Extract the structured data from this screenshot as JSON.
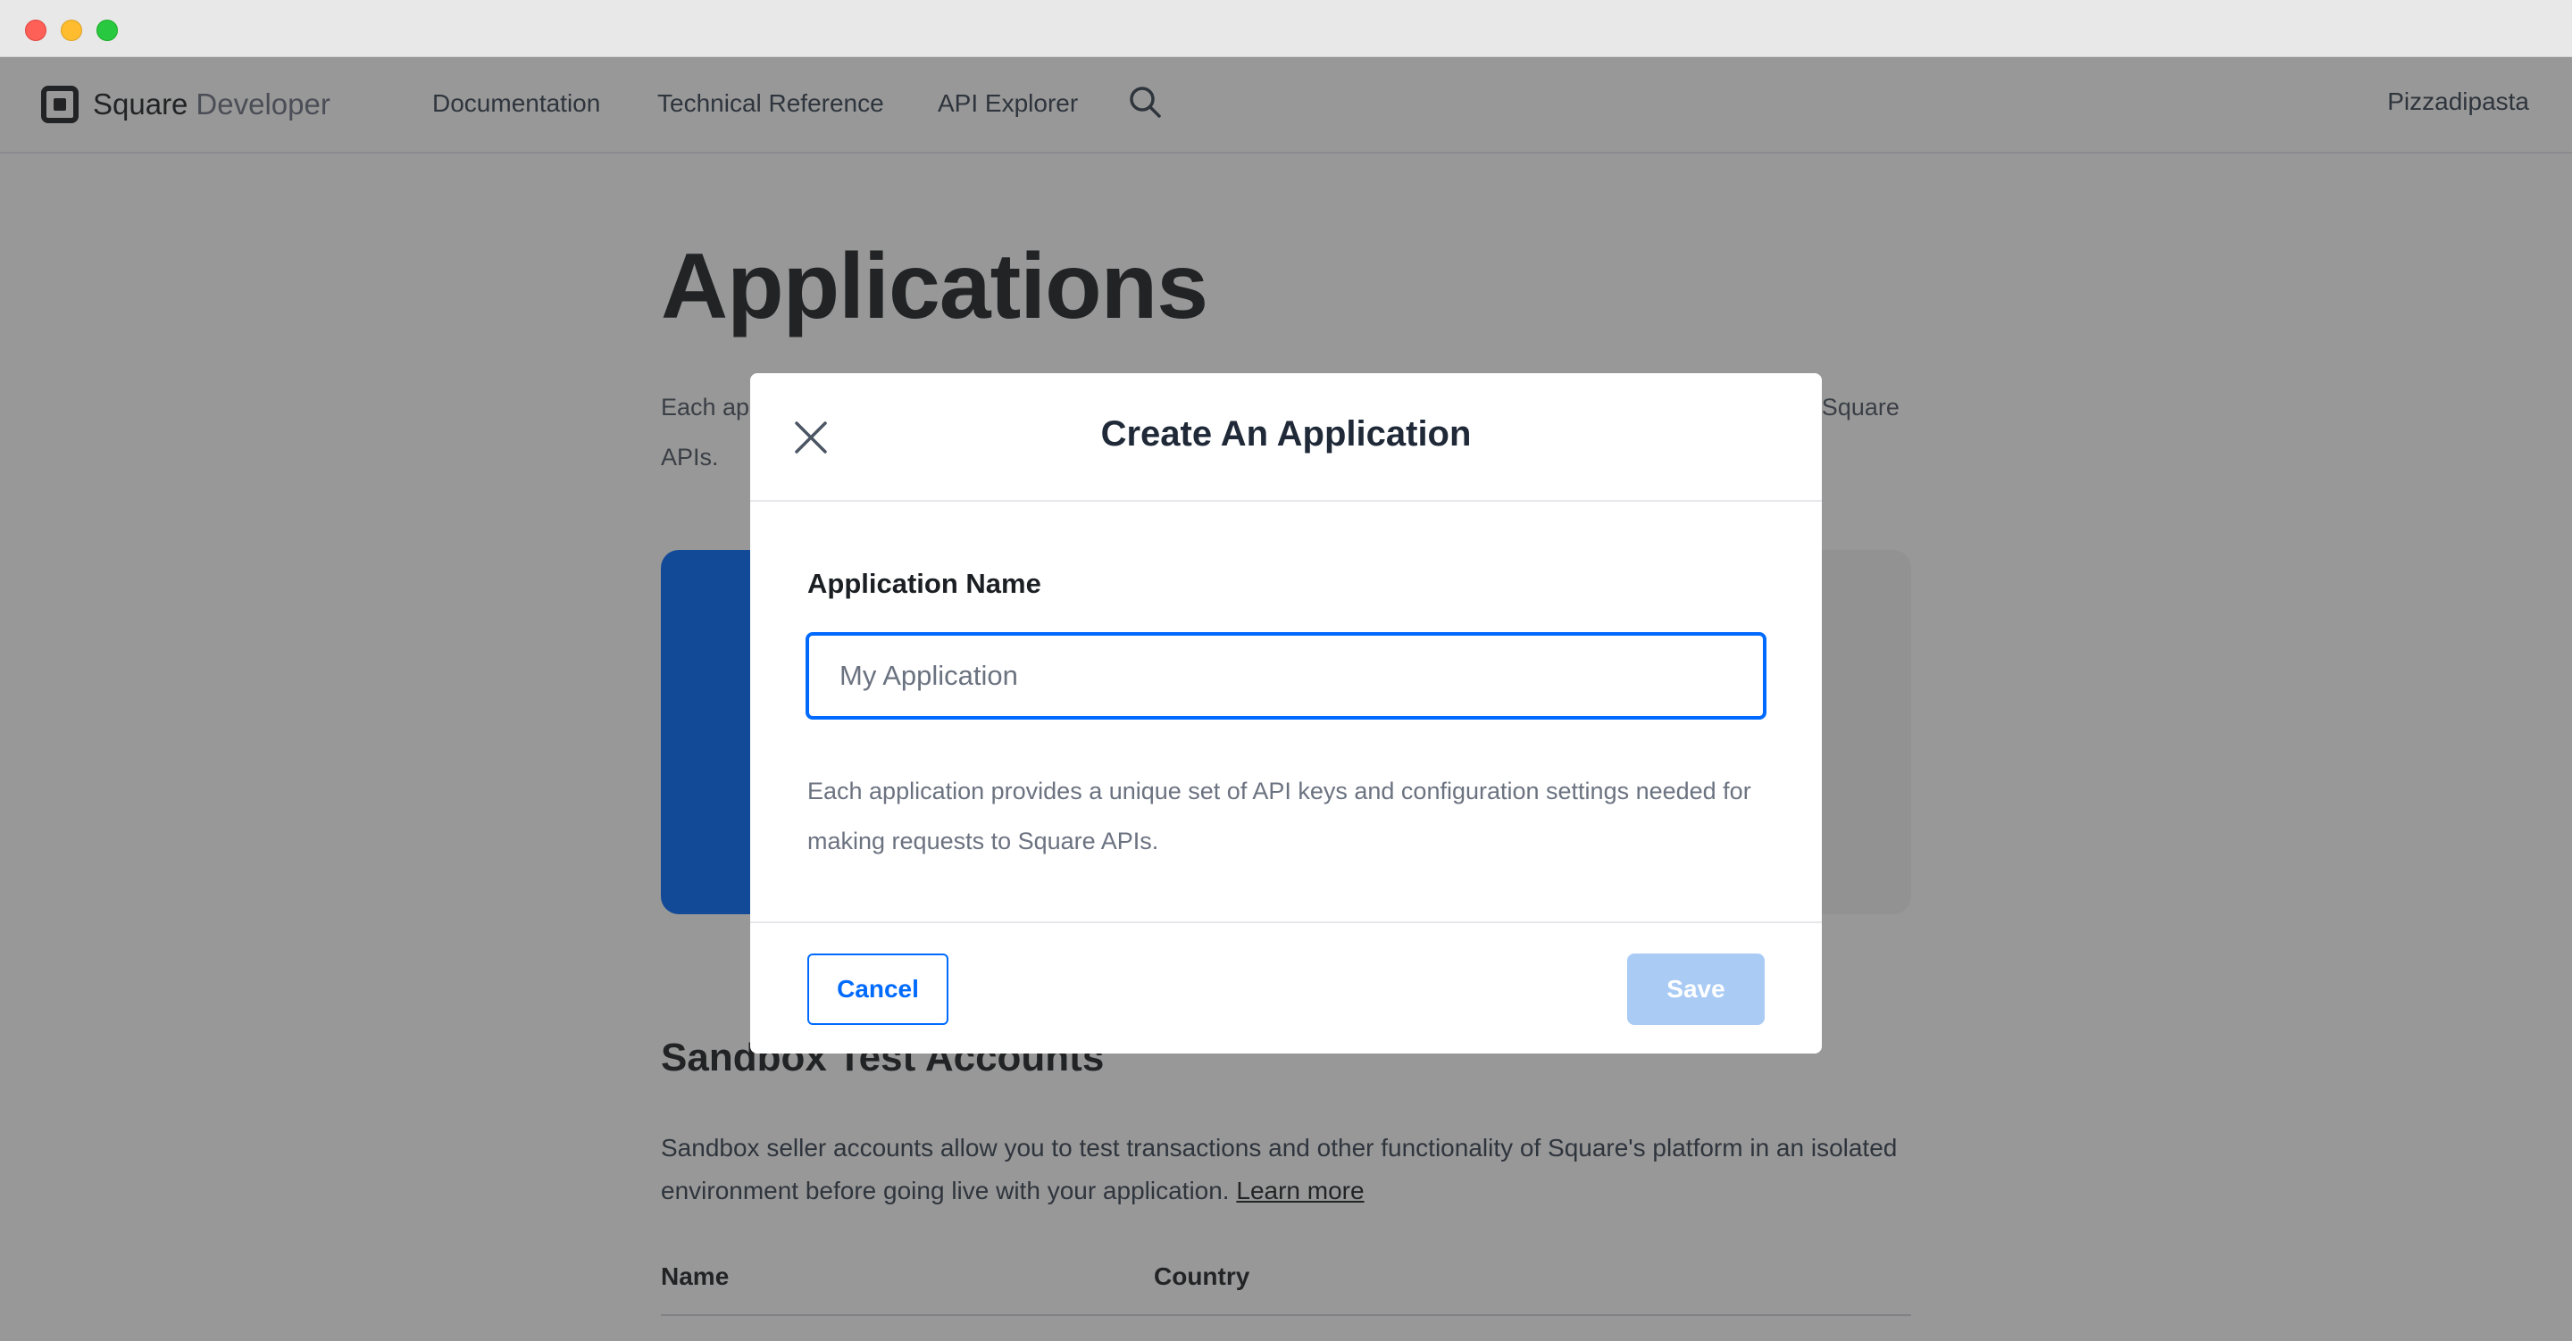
{
  "nav": {
    "brand_primary": "Square",
    "brand_secondary": "Developer",
    "links": [
      "Documentation",
      "Technical Reference",
      "API Explorer"
    ],
    "user": "Pizzadipasta"
  },
  "page": {
    "title": "Applications",
    "intro": "Each application provides a unique set of API keys and configuration settings needed for making requests to Square APIs.",
    "sandbox_title": "Sandbox Test Accounts",
    "sandbox_text": "Sandbox seller accounts allow you to test transactions and other functionality of Square's platform in an isolated environment before going live with your application.",
    "learn_more": "Learn more",
    "table_headers": [
      "Name",
      "Country"
    ]
  },
  "modal": {
    "title": "Create An Application",
    "field_label": "Application Name",
    "input_value": "",
    "input_placeholder": "My Application",
    "help_text": "Each application provides a unique set of API keys and configuration settings needed for making requests to Square APIs.",
    "cancel_label": "Cancel",
    "save_label": "Save"
  },
  "colors": {
    "accent": "#006aff",
    "save_disabled": "#a9cbf4",
    "overlay": "rgba(40,40,40,0.48)"
  },
  "icons": [
    "square-logo-icon",
    "search-icon",
    "close-icon"
  ]
}
